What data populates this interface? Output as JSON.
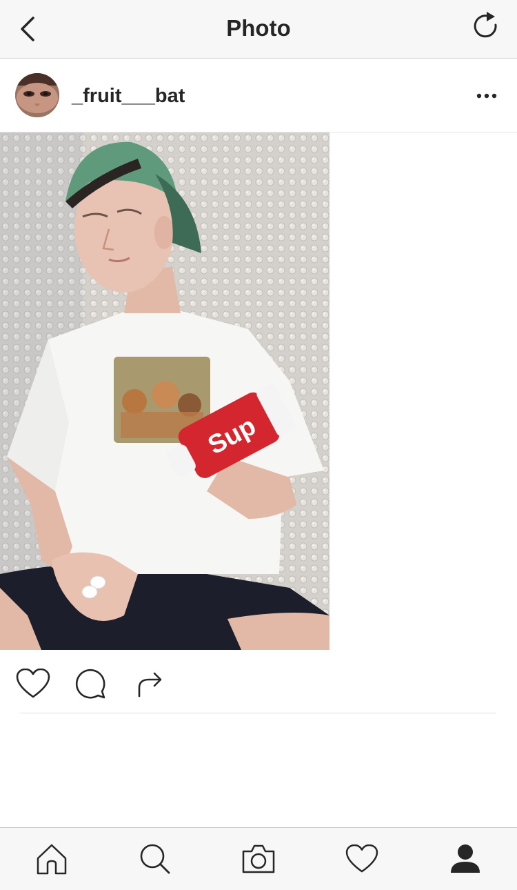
{
  "navbar": {
    "title": "Photo",
    "back_icon": "chevron-left-icon",
    "refresh_icon": "refresh-icon"
  },
  "post": {
    "username": "_fruit___bat",
    "avatar_icon": "avatar",
    "more_icon": "more-horizontal-icon",
    "photo_alt": "Photo",
    "actions": [
      {
        "name": "like",
        "icon": "heart-icon"
      },
      {
        "name": "comment",
        "icon": "comment-icon"
      },
      {
        "name": "share",
        "icon": "share-icon"
      }
    ]
  },
  "tabbar": {
    "items": [
      {
        "name": "home",
        "icon": "home-icon"
      },
      {
        "name": "search",
        "icon": "search-icon"
      },
      {
        "name": "camera",
        "icon": "camera-icon"
      },
      {
        "name": "activity",
        "icon": "heart-icon"
      },
      {
        "name": "profile",
        "icon": "profile-icon",
        "active": true
      }
    ]
  },
  "colors": {
    "bar_bg": "#f7f7f7",
    "text": "#262626",
    "divider": "#e0e0e0"
  }
}
